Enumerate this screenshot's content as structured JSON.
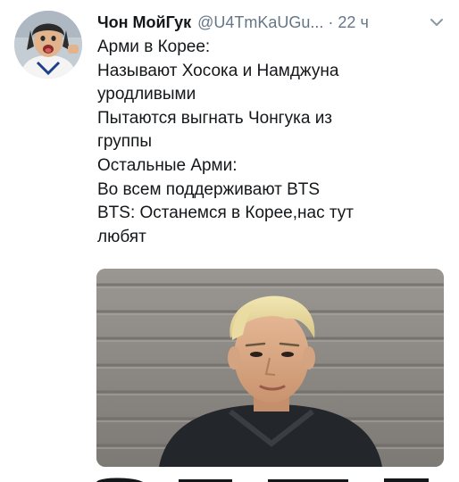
{
  "tweet": {
    "author": {
      "display_name": "Чон МойГук",
      "handle": "@U4TmKaUGu...",
      "avatar_icon": "user-avatar-photo"
    },
    "separator": "·",
    "time": "22 ч",
    "menu_icon": "chevron-down-icon",
    "text_lines": [
      "Арми в Корее:",
      "Называют Хосока и Намджуна",
      "уродливыми",
      "Пытаются выгнать Чонгука из",
      "группы",
      "Остальные Арми:",
      "Во всем поддерживают BTS",
      "BTS: Останемся в Корее,нас тут",
      "любят"
    ],
    "media_icon": "photo-blond-man-icon"
  },
  "colors": {
    "text": "#14171a",
    "secondary": "#657786",
    "background": "#ffffff"
  }
}
